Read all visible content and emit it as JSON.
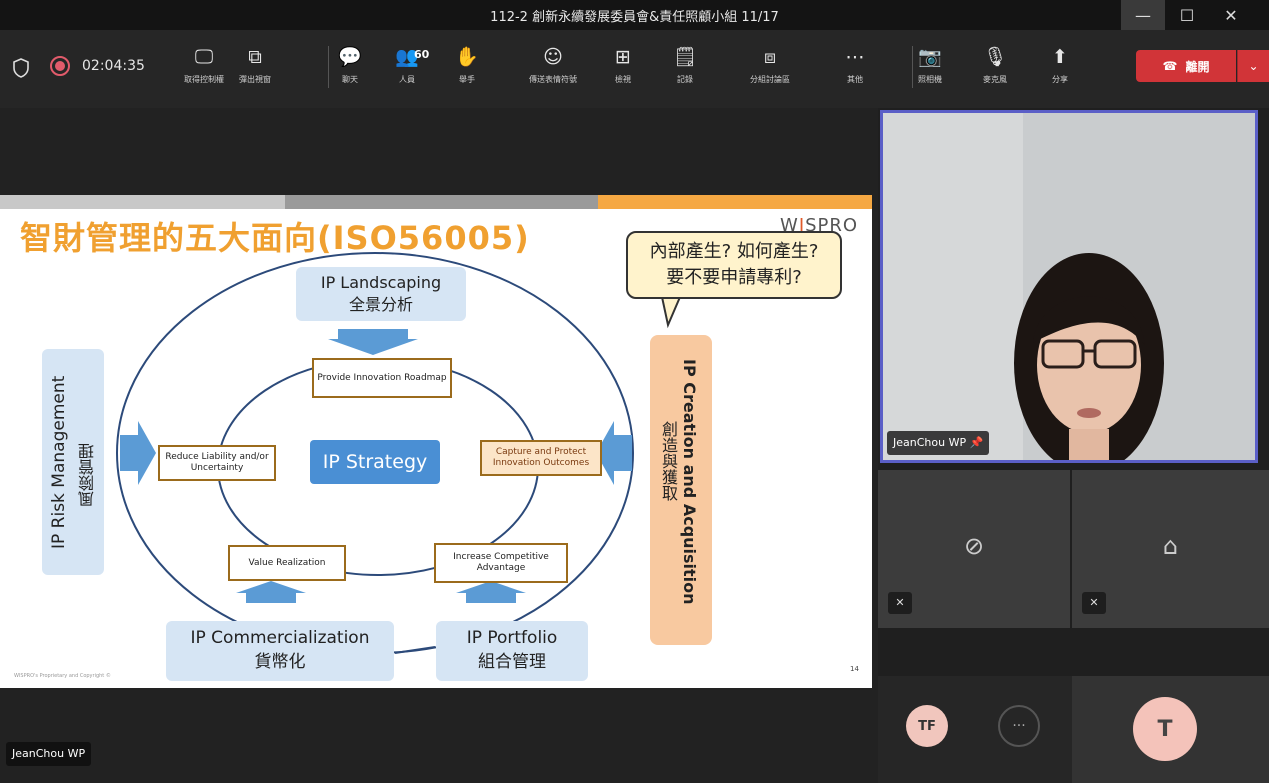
{
  "window": {
    "title": "112-2 創新永續發展委員會&責任照顧小組 11/17"
  },
  "toolbar": {
    "timer": "02:04:35",
    "items": [
      {
        "name": "take-control-button",
        "icon": "desktop-pointer-icon",
        "glyph": "🖵",
        "label": "取得控制權"
      },
      {
        "name": "popout-button",
        "icon": "popout-icon",
        "glyph": "⧉",
        "label": "彈出視窗"
      },
      {
        "name": "chat-button",
        "icon": "chat-icon",
        "glyph": "💬",
        "label": "聊天"
      },
      {
        "name": "people-button",
        "icon": "people-icon",
        "glyph": "👥",
        "label": "人員",
        "count": "60"
      },
      {
        "name": "raise-hand-button",
        "icon": "hand-icon",
        "glyph": "✋",
        "label": "舉手"
      },
      {
        "name": "reactions-button",
        "icon": "smiley-icon",
        "glyph": "☺",
        "label": "傳送表情符號"
      },
      {
        "name": "view-button",
        "icon": "grid-icon",
        "glyph": "⊞",
        "label": "檢視"
      },
      {
        "name": "notes-button",
        "icon": "notes-icon",
        "glyph": "🗒",
        "label": "記錄"
      },
      {
        "name": "breakout-button",
        "icon": "breakout-icon",
        "glyph": "⧈",
        "label": "分組討論區"
      },
      {
        "name": "more-button",
        "icon": "ellipsis-icon",
        "glyph": "⋯",
        "label": "其他"
      },
      {
        "name": "camera-button",
        "icon": "camera-off-icon",
        "glyph": "📷",
        "label": "照相機"
      },
      {
        "name": "mic-button",
        "icon": "mic-off-icon",
        "glyph": "🎙",
        "label": "麥克風"
      },
      {
        "name": "share-button",
        "icon": "share-icon",
        "glyph": "⬆",
        "label": "分享"
      }
    ],
    "leave_label": "離開",
    "leave_icon": "phone-hangup-icon"
  },
  "slide": {
    "title": "智財管理的五大面向(ISO56005)",
    "logo_pre": "W",
    "logo_i": "I",
    "logo_post": "SPRO",
    "callout_line1": "內部產生? 如何產生?",
    "callout_line2": "要不要申請專利?",
    "landscaping_en": "IP Landscaping",
    "landscaping_zh": "全景分析",
    "risk_en": "IP Risk Management",
    "risk_zh": "風險管理",
    "creation_en": "IP Creation and Acquisition",
    "creation_zh": "創造與獲取",
    "commercial_en": "IP Commercialization",
    "commercial_zh": "貨幣化",
    "portfolio_en": "IP Portfolio",
    "portfolio_zh": "組合管理",
    "strategy": "IP Strategy",
    "roadmap": "Provide Innovation Roadmap",
    "reduce": "Reduce Liability and/or Uncertainty",
    "capture": "Capture and Protect Innovation Outcomes",
    "value": "Value Realization",
    "competitive": "Increase Competitive Advantage",
    "footer": "WISPRO's Proprietary and Copyright ©",
    "page": "14"
  },
  "presenter_tag": "JeanChou WP",
  "video": {
    "main_tag": "JeanChou WP"
  },
  "participants": {
    "tf_initials": "TF",
    "t_initials": "T"
  },
  "colors": {
    "accent": "#5b5fc7",
    "leave": "#d13438",
    "slide_title": "#f0a030"
  }
}
